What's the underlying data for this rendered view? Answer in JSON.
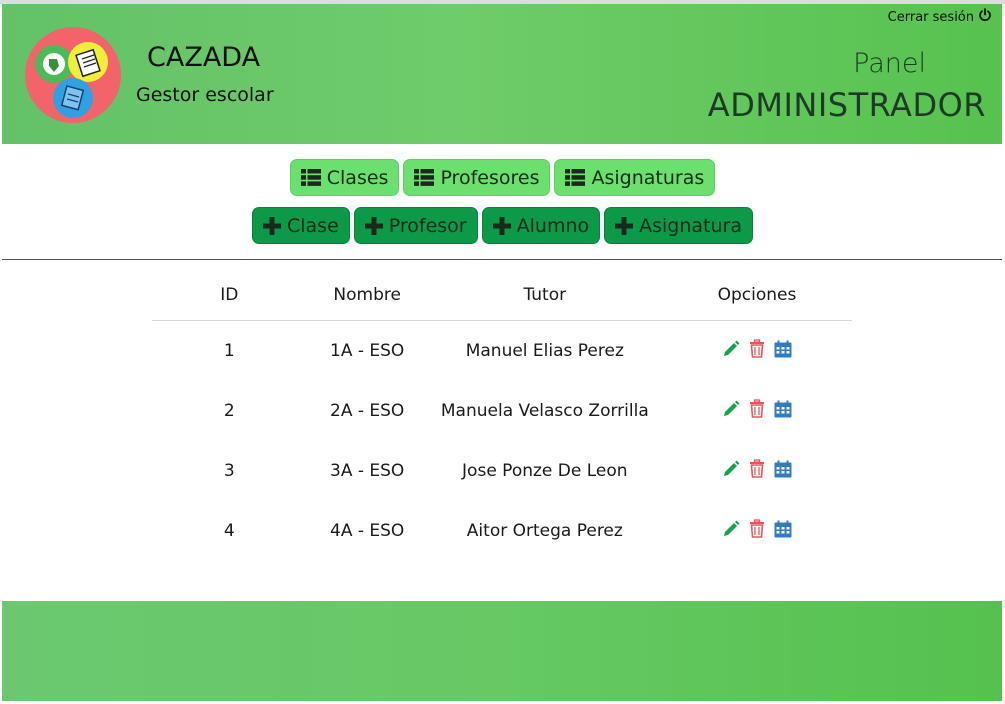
{
  "header": {
    "logout_label": "Cerrar sesión",
    "brand_title": "CAZADA",
    "brand_subtitle": "Gestor escolar",
    "panel_label": "Panel",
    "panel_role": "ADMINISTRADOR"
  },
  "nav": {
    "list_buttons": [
      {
        "label": "Clases",
        "icon": "list-icon"
      },
      {
        "label": "Profesores",
        "icon": "list-icon"
      },
      {
        "label": "Asignaturas",
        "icon": "list-icon"
      }
    ],
    "add_buttons": [
      {
        "label": "Clase",
        "icon": "plus-icon"
      },
      {
        "label": "Profesor",
        "icon": "plus-icon"
      },
      {
        "label": "Alumno",
        "icon": "plus-icon"
      },
      {
        "label": "Asignatura",
        "icon": "plus-icon"
      }
    ]
  },
  "table": {
    "columns": [
      "ID",
      "Nombre",
      "Tutor",
      "Opciones"
    ],
    "rows": [
      {
        "id": "1",
        "nombre": "1A - ESO",
        "tutor": "Manuel Elias Perez"
      },
      {
        "id": "2",
        "nombre": "2A - ESO",
        "tutor": "Manuela Velasco Zorrilla"
      },
      {
        "id": "3",
        "nombre": "3A - ESO",
        "tutor": "Jose Ponze De Leon"
      },
      {
        "id": "4",
        "nombre": "4A - ESO",
        "tutor": "Aitor Ortega Perez"
      }
    ],
    "row_actions": [
      "edit-pencil-icon",
      "delete-trash-icon",
      "calendar-icon"
    ]
  },
  "colors": {
    "header_green": "#63c268",
    "button_light": "#6be06f",
    "button_dark": "#0c9a48",
    "edit": "#16a34a",
    "delete": "#e8565a",
    "calendar": "#2f7cc4"
  }
}
